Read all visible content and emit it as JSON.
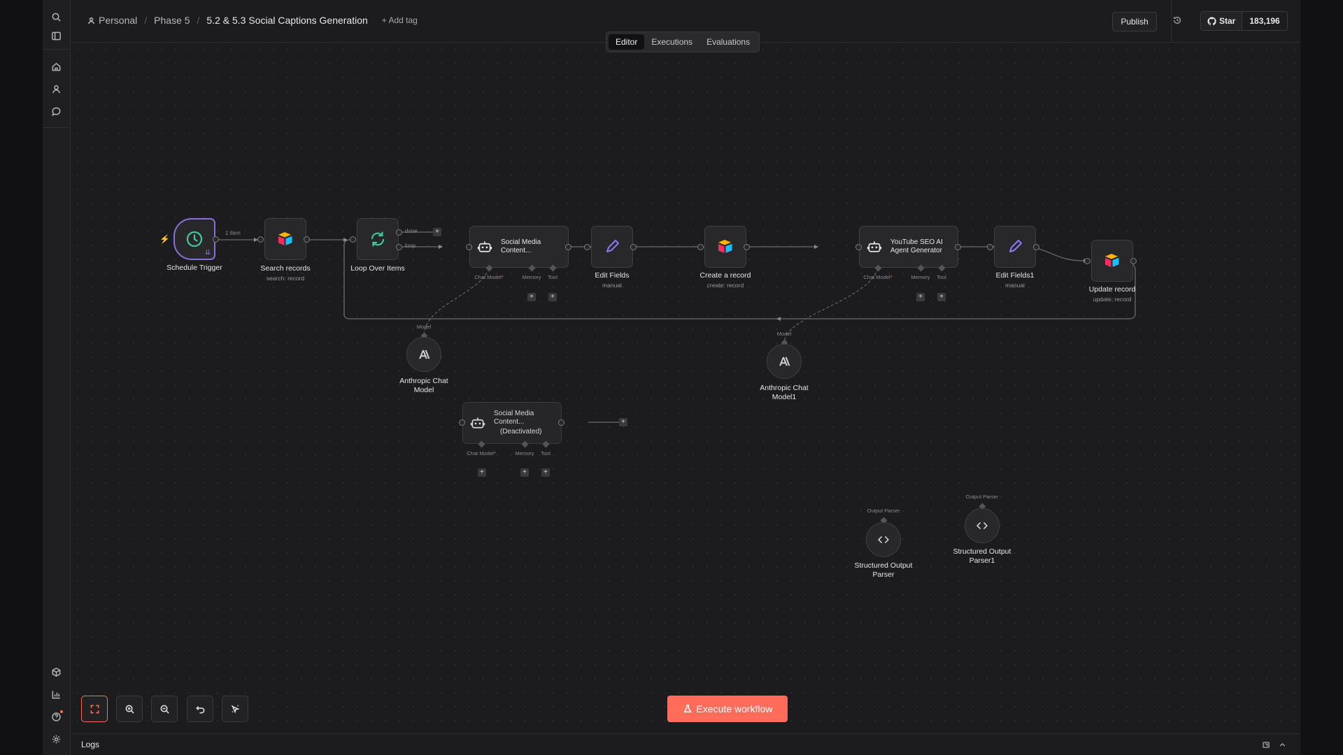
{
  "breadcrumb": {
    "owner": "Personal",
    "folder": "Phase 5",
    "workflow": "5.2 & 5.3 Social Captions Generation",
    "add_tag": "+ Add tag"
  },
  "header": {
    "publish": "Publish",
    "github_star": "Star",
    "github_count": "183,196"
  },
  "tabs": [
    "Editor",
    "Executions",
    "Evaluations"
  ],
  "active_tab": "Editor",
  "nodes": {
    "schedule": {
      "label": "Schedule Trigger"
    },
    "search": {
      "label": "Search records",
      "sub": "search: record"
    },
    "loop": {
      "label": "Loop Over Items",
      "out_done": "done",
      "out_loop": "loop"
    },
    "agent1": {
      "title1": "Social Media",
      "title2": "Content..."
    },
    "edit1": {
      "label": "Edit Fields",
      "sub": "manual"
    },
    "create": {
      "label": "Create a record",
      "sub": "create: record"
    },
    "agent2": {
      "title1": "YouTube SEO AI",
      "title2": "Agent Generator"
    },
    "edit2": {
      "label": "Edit Fields1",
      "sub": "manual"
    },
    "update": {
      "label": "Update record",
      "sub": "update: record"
    },
    "anth1": {
      "label1": "Anthropic Chat",
      "label2": "Model"
    },
    "anth2": {
      "label1": "Anthropic Chat",
      "label2": "Model1"
    },
    "agent3": {
      "title1": "Social Media",
      "title2": "Content...",
      "status": "(Deactivated)"
    },
    "parser1": {
      "label1": "Structured Output",
      "label2": "Parser"
    },
    "parser2": {
      "label1": "Structured Output",
      "label2": "Parser1"
    }
  },
  "ports": {
    "chat_model": "Chat Model",
    "memory": "Memory",
    "tool": "Tool",
    "model": "Model",
    "output_parser": "Output Parser"
  },
  "edge_label": "1 item",
  "execute_button": "Execute workflow",
  "logs": {
    "title": "Logs"
  },
  "colors": {
    "accent": "#ff6d5a",
    "trigger_border": "#8b6fd6",
    "clock": "#3fc99a",
    "loop": "#3fc99a",
    "pencil": "#8a7cf5"
  }
}
